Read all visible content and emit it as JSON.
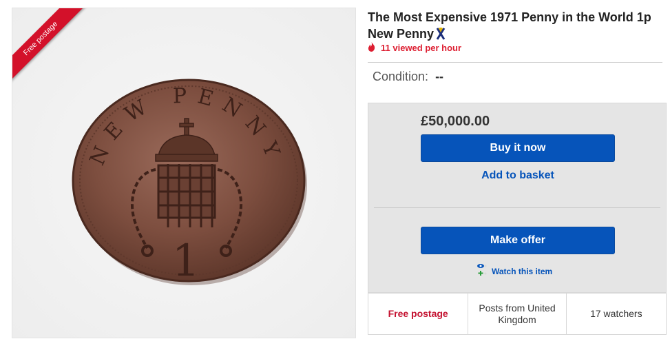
{
  "listing": {
    "title": "The Most Expensive 1971 Penny in the World 1p New Penny",
    "views": "11 viewed per hour",
    "condition_label": "Condition:",
    "condition_value": "--"
  },
  "image": {
    "ribbon": "Free postage",
    "coin_legend": "NEW PENNY",
    "coin_value": "1"
  },
  "buybox": {
    "price": "£50,000.00",
    "buy_now": "Buy it now",
    "add_to_basket": "Add to basket",
    "make_offer": "Make offer",
    "watch": "Watch this item"
  },
  "infobar": {
    "postage": "Free postage",
    "posts_from": "Posts from United Kingdom",
    "watchers": "17 watchers"
  },
  "colors": {
    "primary_blue": "#0654ba",
    "alert_red": "#dd1e31",
    "ribbon_red": "#d3112a",
    "coin_bronze": "#7a4b3a"
  },
  "icons": [
    "award-ribbon-icon",
    "fire-icon",
    "watch-eye-icon"
  ]
}
